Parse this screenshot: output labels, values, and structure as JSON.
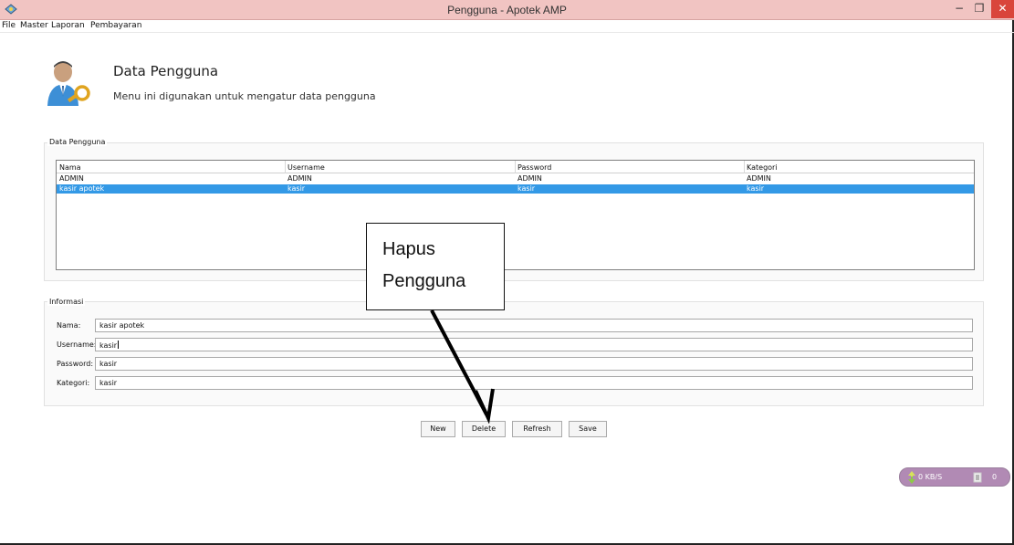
{
  "window": {
    "title": "Pengguna - Apotek AMP",
    "controls": {
      "minimize": "−",
      "maximize": "❐",
      "close": "✕"
    }
  },
  "menu": [
    "File",
    "Master",
    "Laporan",
    "Pembayaran"
  ],
  "header": {
    "title": "Data Pengguna",
    "subtitle": "Menu ini digunakan untuk mengatur data pengguna",
    "icon": "user-key-icon"
  },
  "table_group": {
    "label": "Data Pengguna",
    "columns": [
      "Nama",
      "Username",
      "Password",
      "Kategori"
    ],
    "rows": [
      [
        "ADMIN",
        "ADMIN",
        "ADMIN",
        "ADMIN"
      ],
      [
        "kasir apotek",
        "kasir",
        "kasir",
        "kasir"
      ]
    ],
    "selected_row": 1
  },
  "info_group": {
    "label": "Informasi",
    "fields": [
      {
        "label": "Nama:",
        "value": "kasir apotek"
      },
      {
        "label": "Username:",
        "value": "kasir"
      },
      {
        "label": "Password:",
        "value": "kasir"
      },
      {
        "label": "Kategori:",
        "value": "kasir"
      }
    ]
  },
  "buttons": {
    "new": "New",
    "delete": "Delete",
    "refresh": "Refresh",
    "save": "Save"
  },
  "callout": {
    "line1": "Hapus",
    "line2": "Pengguna"
  },
  "network_widget": {
    "speed": "0 KB/S",
    "count": "0",
    "color": "#b18ab4"
  },
  "colors": {
    "selection": "#3399e6",
    "titlebar": "#f1c4c2",
    "close": "#d9453b"
  }
}
